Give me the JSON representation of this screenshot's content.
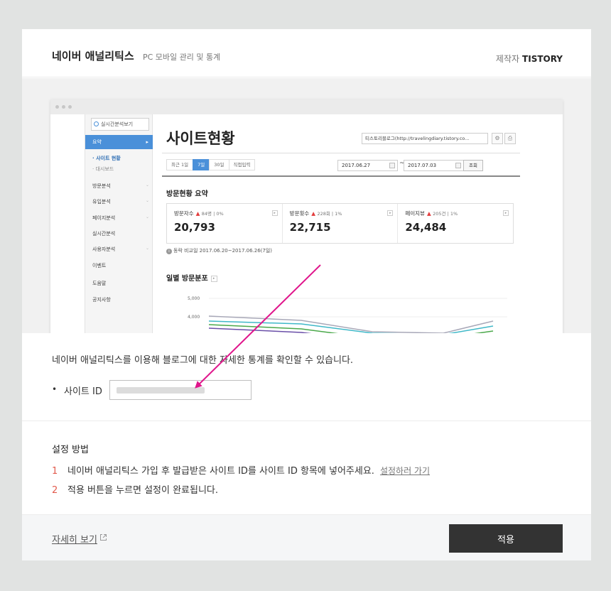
{
  "header": {
    "plugin_name": "네이버 애널리틱스",
    "plugin_sub": "PC 모바일 관리 및 통계",
    "maker_label": "제작자",
    "maker_name": "TISTORY"
  },
  "preview": {
    "realtime_button": "실시간분석보기",
    "sidebar": {
      "active": "요약",
      "sub_items": [
        "· 사이트 현황",
        "· 대시보드"
      ],
      "items": [
        "방문분석",
        "유입분석",
        "페이지분석",
        "실시간분석",
        "사용자분석",
        "이벤트",
        "도움말",
        "공지사항"
      ]
    },
    "page_title": "사이트현황",
    "blog_select": "티스토리블로그(http://travelingdiary.tistory.co...",
    "tabs": [
      "최근 1일",
      "7일",
      "30일",
      "직접입력"
    ],
    "date_from": "2017.06.27",
    "date_sep": "~",
    "date_to": "2017.07.03",
    "query_button": "조회",
    "summary_title": "방문현황 요약",
    "stats": [
      {
        "label": "방문자수",
        "delta": "84명",
        "pct": "0%",
        "value": "20,793"
      },
      {
        "label": "방문횟수",
        "delta": "228회",
        "pct": "1%",
        "value": "22,715"
      },
      {
        "label": "페이지뷰",
        "delta": "205건",
        "pct": "1%",
        "value": "24,484"
      }
    ],
    "compare_text": "동락 비교일  2017.06.20~2017.06.26(7일)",
    "daily_title": "일별 방문분포",
    "y_ticks": [
      "5,000",
      "4,000"
    ],
    "series_colors": [
      "#a8a8b8",
      "#3fb8c8",
      "#4aa84a",
      "#6a4fa8"
    ]
  },
  "description": "네이버 애널리틱스를 이용해 블로그에 대한 자세한 통계를 확인할 수 있습니다.",
  "site_id": {
    "bullet": "•",
    "label": "사이트 ID",
    "value": ""
  },
  "howto": {
    "title": "설정 방법",
    "steps": [
      {
        "num": "1",
        "text": "네이버 애널리틱스 가입 후 발급받은 사이트 ID를 사이트 ID 항목에 넣어주세요.",
        "link": "설정하러 가기"
      },
      {
        "num": "2",
        "text": "적용 버튼을 누르면 설정이 완료됩니다."
      }
    ]
  },
  "footer": {
    "detail_link": "자세히 보기",
    "apply_button": "적용"
  },
  "colors": {
    "accent_blue": "#4a90d9",
    "arrow": "#e0168c",
    "step_number": "#e25a4c",
    "apply_button_bg": "#333333"
  }
}
